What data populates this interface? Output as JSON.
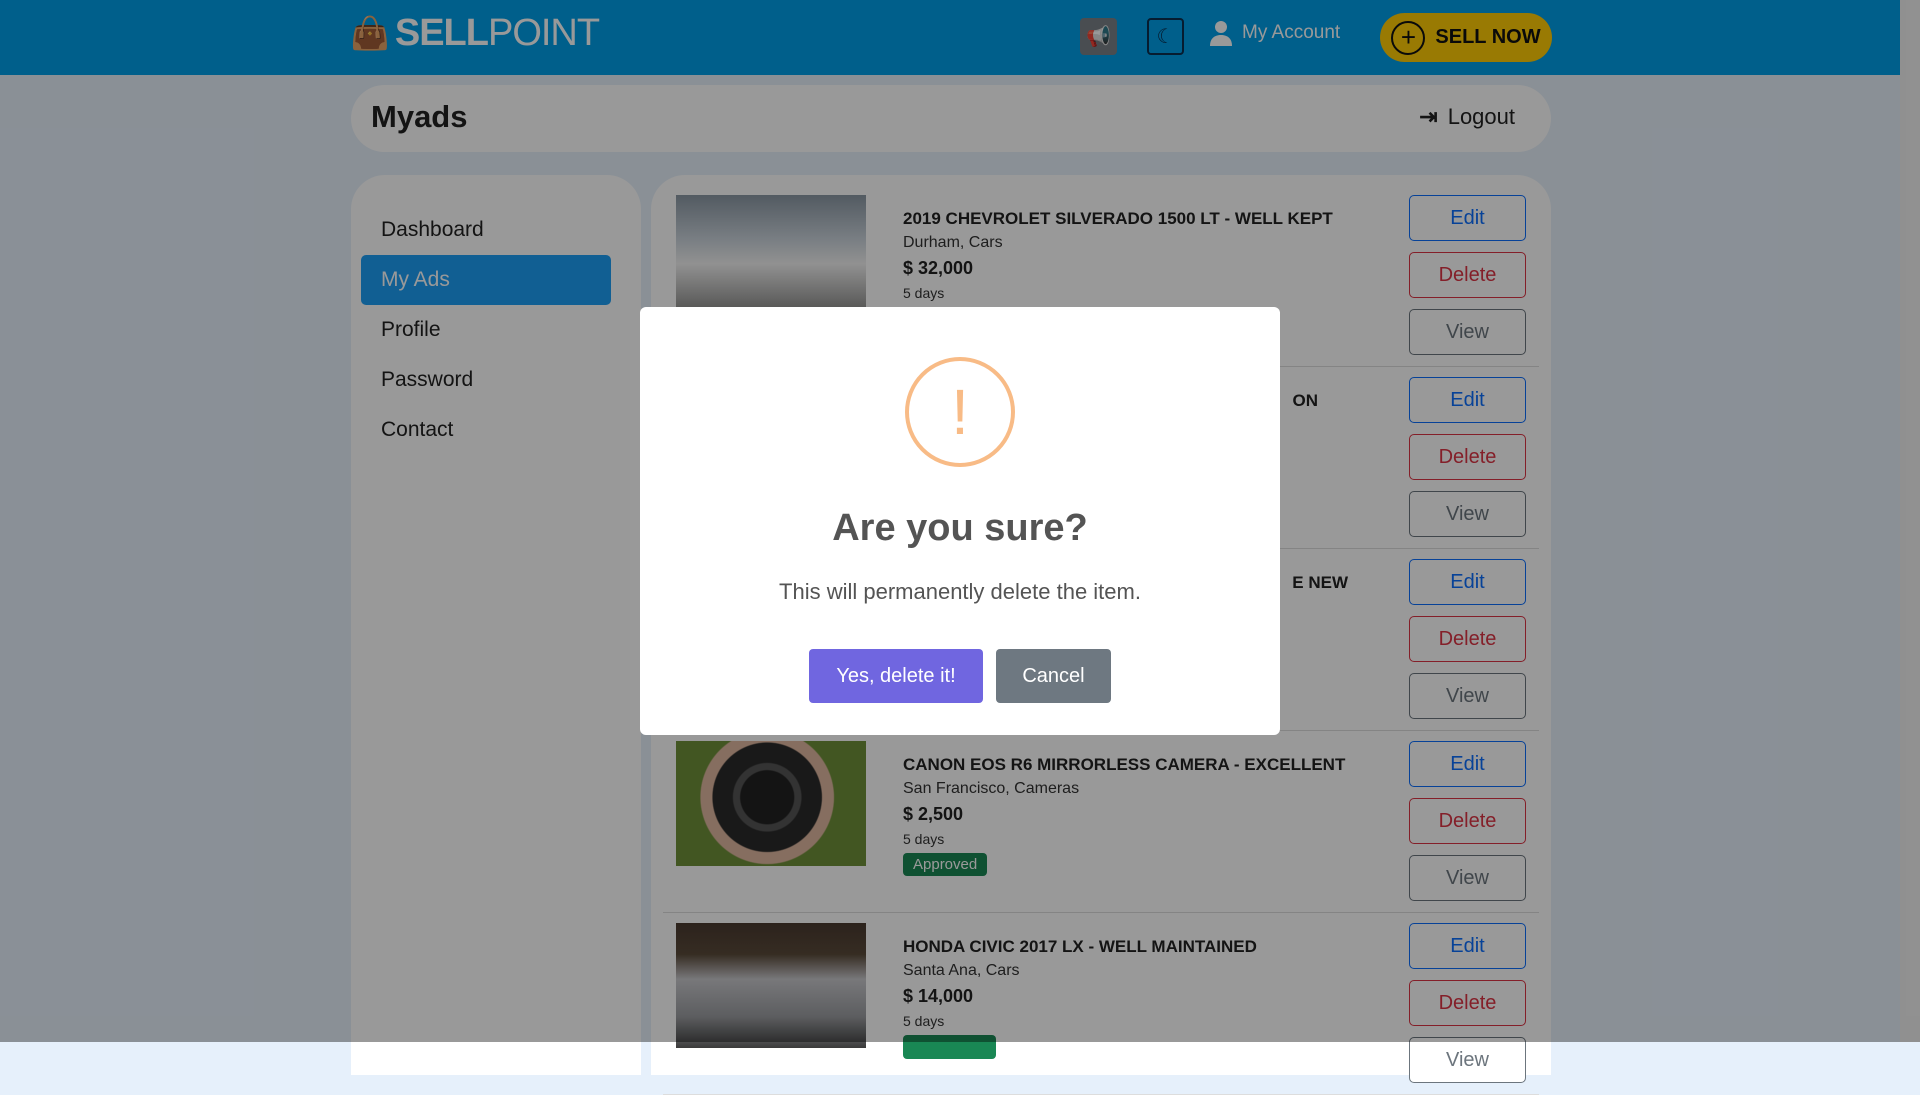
{
  "header": {
    "logo_bold": "SELL",
    "logo_light": "POINT",
    "account_label": "My Account",
    "sell_label": "SELL NOW"
  },
  "titlebar": {
    "title": "Myads",
    "logout_label": "Logout"
  },
  "sidebar": {
    "items": [
      {
        "label": "Dashboard"
      },
      {
        "label": "My Ads"
      },
      {
        "label": "Profile"
      },
      {
        "label": "Password"
      },
      {
        "label": "Contact"
      }
    ]
  },
  "ads": [
    {
      "title": "2019 CHEVROLET SILVERADO 1500 LT - WELL KEPT",
      "location": "Durham, Cars",
      "price": "$ 32,000",
      "age": "5 days"
    },
    {
      "title_visible": "ON"
    },
    {
      "title_visible": "E NEW"
    },
    {
      "title": "CANON EOS R6 MIRRORLESS CAMERA - EXCELLENT",
      "location": "San Francisco, Cameras",
      "price": "$ 2,500",
      "age": "5 days",
      "status": "Approved"
    },
    {
      "title": "HONDA CIVIC 2017 LX - WELL MAINTAINED",
      "location": "Santa Ana, Cars",
      "price": "$ 14,000",
      "age": "5 days"
    }
  ],
  "actions": {
    "edit": "Edit",
    "delete": "Delete",
    "view": "View"
  },
  "modal": {
    "icon": "!",
    "title": "Are you sure?",
    "text": "This will permanently delete the item.",
    "confirm": "Yes, delete it!",
    "cancel": "Cancel"
  }
}
